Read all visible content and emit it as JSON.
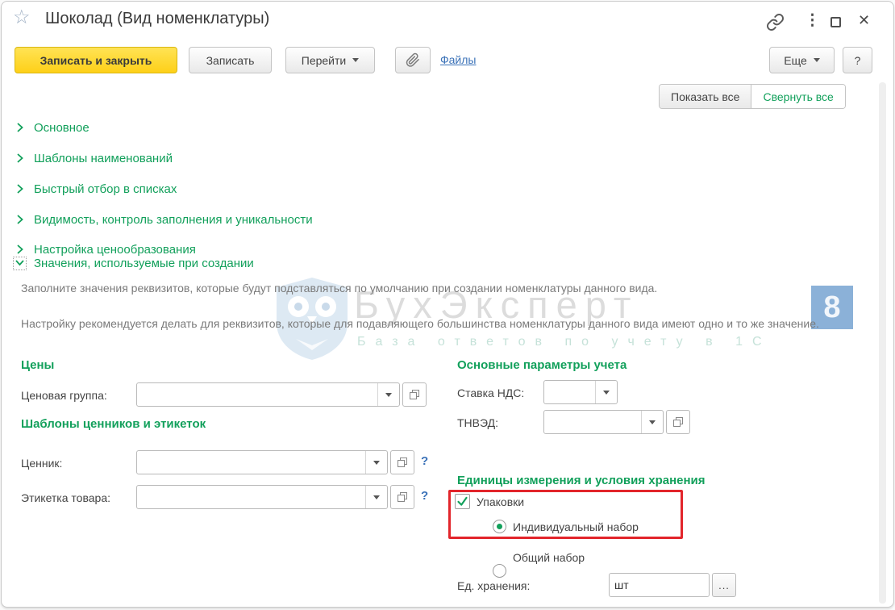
{
  "window": {
    "title": "Шоколад (Вид номенклатуры)"
  },
  "toolbar": {
    "save_and_close": "Записать и закрыть",
    "save": "Записать",
    "goto": "Перейти",
    "files": "Файлы",
    "more": "Еще",
    "help": "?"
  },
  "view_controls": {
    "show_all": "Показать все",
    "collapse_all": "Свернуть все"
  },
  "sections": {
    "collapsed": [
      "Основное",
      "Шаблоны наименований",
      "Быстрый отбор в списках",
      "Видимость, контроль заполнения и уникальности",
      "Настройка ценообразования"
    ],
    "expanded": "Значения, используемые при создании"
  },
  "description": {
    "para1": "Заполните значения реквизитов, которые будут подставляться по умолчанию при создании номенклатуры данного вида.",
    "para2": "Настройку рекомендуется делать для реквизитов, которые для подавляющего большинства номенклатуры данного вида имеют одно и то же значение."
  },
  "prices": {
    "heading": "Цены",
    "price_group_label": "Ценовая группа:",
    "price_group_value": ""
  },
  "tag_templates": {
    "heading": "Шаблоны ценников и этикеток",
    "price_tag_label": "Ценник:",
    "product_label_label": "Этикетка товара:",
    "help": "?"
  },
  "accounting": {
    "heading": "Основные параметры учета",
    "vat_label": "Ставка НДС:",
    "vat_value": "",
    "tnved_label": "ТНВЭД:",
    "tnved_value": ""
  },
  "units": {
    "heading": "Единицы измерения и условия хранения",
    "packages_label": "Упаковки",
    "packages_checked": true,
    "individual_set_label": "Индивидуальный набор",
    "individual_set_selected": true,
    "common_set_label": "Общий набор",
    "common_set_selected": false,
    "storage_unit_label": "Ед. хранения:",
    "storage_unit_value": "шт",
    "select_button": "..."
  },
  "watermark": {
    "brand": "БухЭксперт",
    "badge": "8",
    "tagline": "База ответов по учету в 1С"
  },
  "colors": {
    "green": "#12a05b",
    "red": "#e2252b",
    "blue-link": "#3b72b8",
    "label": "#444444",
    "desc": "#7a7a7a",
    "yellow": "#ffd21c",
    "yellow-border": "#d9b713",
    "border": "#c4c4c4"
  }
}
